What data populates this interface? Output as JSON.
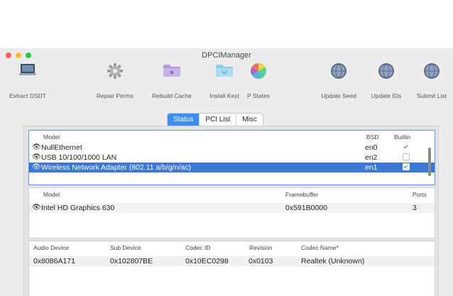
{
  "app": {
    "title": "DPCIManager"
  },
  "toolbar": {
    "extract_dsdt": "Extract DSDT",
    "repair_perms": "Repair Perms",
    "rebuild_cache": "Rebuild Cache",
    "install_kext": "Install Kext",
    "p_states": "P States",
    "update_seed": "Update Seed",
    "update_ids": "Update IDs",
    "submit_list": "Submit List"
  },
  "tabs": {
    "status": "Status",
    "pci_list": "PCI List",
    "misc": "Misc"
  },
  "network": {
    "headers": {
      "model": "Model",
      "bsd": "BSD",
      "builtin": "Builtin"
    },
    "rows": [
      {
        "model": "NullEthernet",
        "bsd": "en0",
        "builtin": true
      },
      {
        "model": "USB 10/100/1000 LAN",
        "bsd": "en2",
        "builtin": false
      },
      {
        "model": "Wireless Network Adapter (802.11 a/b/g/n/ac)",
        "bsd": "en1",
        "builtin": true
      }
    ]
  },
  "graphics": {
    "headers": {
      "model": "Model",
      "framebuffer": "Framebuffer",
      "ports": "Ports"
    },
    "rows": [
      {
        "model": "Intel HD Graphics 630",
        "framebuffer": "0x591B0000",
        "ports": "3"
      }
    ]
  },
  "audio": {
    "headers": {
      "audio_device": "Audio Device",
      "sub_device": "Sub Device",
      "codec_id": "Codec ID",
      "revision": "Revision",
      "codec_name": "Codec Name*"
    },
    "rows": [
      {
        "audio_device": "0x8086A171",
        "sub_device": "0x102807BE",
        "codec_id": "0x10EC0298",
        "revision": "0x0103",
        "codec_name": "Realtek (Unknown)"
      }
    ]
  },
  "colors": {
    "selection": "#3b78d6",
    "tab_active": "#3c8ef0",
    "close": "#ff5f57",
    "minimize": "#febc2e",
    "zoom": "#28c840"
  }
}
